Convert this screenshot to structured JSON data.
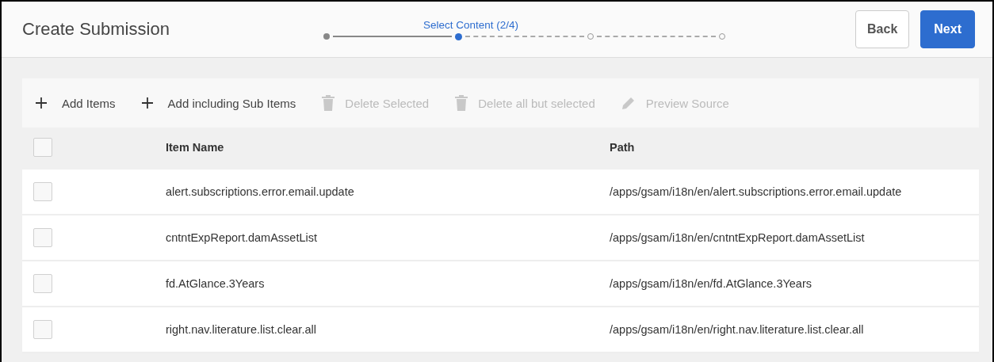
{
  "header": {
    "title": "Create Submission",
    "steps": [
      {
        "completed": true,
        "selected": false
      },
      {
        "completed": false,
        "selected": true,
        "label": "Select Content (2/4)"
      },
      {
        "completed": false,
        "selected": false
      },
      {
        "completed": false,
        "selected": false
      }
    ],
    "buttons": [
      {
        "label": "Back",
        "kind": "secondary"
      },
      {
        "label": "Next",
        "kind": "primary"
      }
    ]
  },
  "toolbar": [
    {
      "label": "Add Items",
      "kind": "add",
      "disabled": false
    },
    {
      "label": "Add including Sub Items",
      "kind": "add",
      "disabled": false
    },
    {
      "label": "Delete Selected",
      "kind": "delete",
      "disabled": true
    },
    {
      "label": "Delete all but selected",
      "kind": "delete",
      "disabled": true
    },
    {
      "label": "Preview Source",
      "kind": "edit",
      "disabled": true
    }
  ],
  "table": {
    "select_all_checked": false,
    "columns": [
      "Item Name",
      "Path"
    ],
    "rows": [
      {
        "checked": false,
        "cells": [
          "alert.subscriptions.error.email.update",
          "/apps/gsam/i18n/en/alert.subscriptions.error.email.update"
        ]
      },
      {
        "checked": false,
        "cells": [
          "cntntExpReport.damAssetList",
          "/apps/gsam/i18n/en/cntntExpReport.damAssetList"
        ]
      },
      {
        "checked": false,
        "cells": [
          "fd.AtGlance.3Years",
          "/apps/gsam/i18n/en/fd.AtGlance.3Years"
        ]
      },
      {
        "checked": false,
        "cells": [
          "right.nav.literature.list.clear.all",
          "/apps/gsam/i18n/en/right.nav.literature.list.clear.all"
        ]
      }
    ]
  }
}
